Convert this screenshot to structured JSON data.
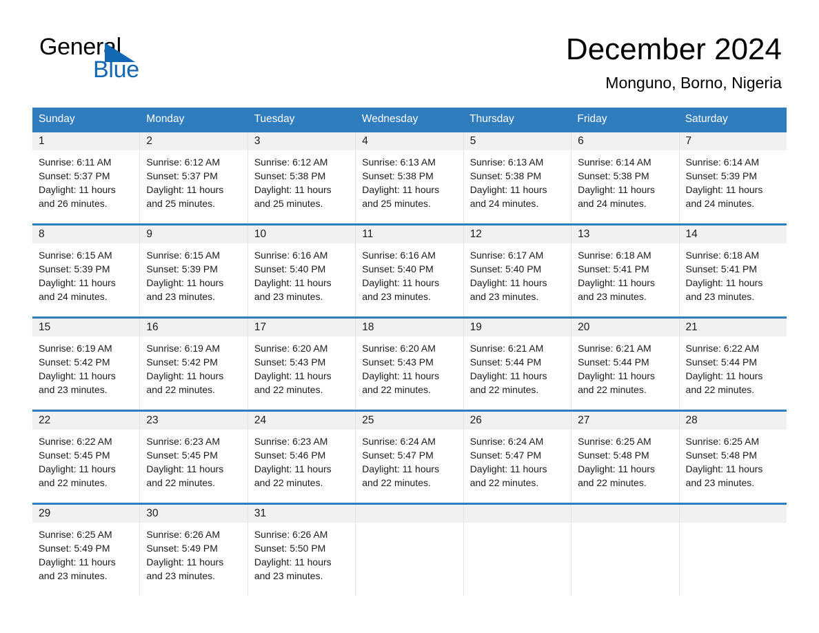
{
  "brand": {
    "name_part1": "General",
    "name_part2": "Blue",
    "accent_color": "#1268b3"
  },
  "header": {
    "month_title": "December 2024",
    "location": "Monguno, Borno, Nigeria"
  },
  "calendar": {
    "header_color": "#2f7cbf",
    "weekdays": [
      "Sunday",
      "Monday",
      "Tuesday",
      "Wednesday",
      "Thursday",
      "Friday",
      "Saturday"
    ],
    "weeks": [
      [
        {
          "day": "1",
          "sunrise": "Sunrise: 6:11 AM",
          "sunset": "Sunset: 5:37 PM",
          "daylight_line1": "Daylight: 11 hours",
          "daylight_line2": "and 26 minutes."
        },
        {
          "day": "2",
          "sunrise": "Sunrise: 6:12 AM",
          "sunset": "Sunset: 5:37 PM",
          "daylight_line1": "Daylight: 11 hours",
          "daylight_line2": "and 25 minutes."
        },
        {
          "day": "3",
          "sunrise": "Sunrise: 6:12 AM",
          "sunset": "Sunset: 5:38 PM",
          "daylight_line1": "Daylight: 11 hours",
          "daylight_line2": "and 25 minutes."
        },
        {
          "day": "4",
          "sunrise": "Sunrise: 6:13 AM",
          "sunset": "Sunset: 5:38 PM",
          "daylight_line1": "Daylight: 11 hours",
          "daylight_line2": "and 25 minutes."
        },
        {
          "day": "5",
          "sunrise": "Sunrise: 6:13 AM",
          "sunset": "Sunset: 5:38 PM",
          "daylight_line1": "Daylight: 11 hours",
          "daylight_line2": "and 24 minutes."
        },
        {
          "day": "6",
          "sunrise": "Sunrise: 6:14 AM",
          "sunset": "Sunset: 5:38 PM",
          "daylight_line1": "Daylight: 11 hours",
          "daylight_line2": "and 24 minutes."
        },
        {
          "day": "7",
          "sunrise": "Sunrise: 6:14 AM",
          "sunset": "Sunset: 5:39 PM",
          "daylight_line1": "Daylight: 11 hours",
          "daylight_line2": "and 24 minutes."
        }
      ],
      [
        {
          "day": "8",
          "sunrise": "Sunrise: 6:15 AM",
          "sunset": "Sunset: 5:39 PM",
          "daylight_line1": "Daylight: 11 hours",
          "daylight_line2": "and 24 minutes."
        },
        {
          "day": "9",
          "sunrise": "Sunrise: 6:15 AM",
          "sunset": "Sunset: 5:39 PM",
          "daylight_line1": "Daylight: 11 hours",
          "daylight_line2": "and 23 minutes."
        },
        {
          "day": "10",
          "sunrise": "Sunrise: 6:16 AM",
          "sunset": "Sunset: 5:40 PM",
          "daylight_line1": "Daylight: 11 hours",
          "daylight_line2": "and 23 minutes."
        },
        {
          "day": "11",
          "sunrise": "Sunrise: 6:16 AM",
          "sunset": "Sunset: 5:40 PM",
          "daylight_line1": "Daylight: 11 hours",
          "daylight_line2": "and 23 minutes."
        },
        {
          "day": "12",
          "sunrise": "Sunrise: 6:17 AM",
          "sunset": "Sunset: 5:40 PM",
          "daylight_line1": "Daylight: 11 hours",
          "daylight_line2": "and 23 minutes."
        },
        {
          "day": "13",
          "sunrise": "Sunrise: 6:18 AM",
          "sunset": "Sunset: 5:41 PM",
          "daylight_line1": "Daylight: 11 hours",
          "daylight_line2": "and 23 minutes."
        },
        {
          "day": "14",
          "sunrise": "Sunrise: 6:18 AM",
          "sunset": "Sunset: 5:41 PM",
          "daylight_line1": "Daylight: 11 hours",
          "daylight_line2": "and 23 minutes."
        }
      ],
      [
        {
          "day": "15",
          "sunrise": "Sunrise: 6:19 AM",
          "sunset": "Sunset: 5:42 PM",
          "daylight_line1": "Daylight: 11 hours",
          "daylight_line2": "and 23 minutes."
        },
        {
          "day": "16",
          "sunrise": "Sunrise: 6:19 AM",
          "sunset": "Sunset: 5:42 PM",
          "daylight_line1": "Daylight: 11 hours",
          "daylight_line2": "and 22 minutes."
        },
        {
          "day": "17",
          "sunrise": "Sunrise: 6:20 AM",
          "sunset": "Sunset: 5:43 PM",
          "daylight_line1": "Daylight: 11 hours",
          "daylight_line2": "and 22 minutes."
        },
        {
          "day": "18",
          "sunrise": "Sunrise: 6:20 AM",
          "sunset": "Sunset: 5:43 PM",
          "daylight_line1": "Daylight: 11 hours",
          "daylight_line2": "and 22 minutes."
        },
        {
          "day": "19",
          "sunrise": "Sunrise: 6:21 AM",
          "sunset": "Sunset: 5:44 PM",
          "daylight_line1": "Daylight: 11 hours",
          "daylight_line2": "and 22 minutes."
        },
        {
          "day": "20",
          "sunrise": "Sunrise: 6:21 AM",
          "sunset": "Sunset: 5:44 PM",
          "daylight_line1": "Daylight: 11 hours",
          "daylight_line2": "and 22 minutes."
        },
        {
          "day": "21",
          "sunrise": "Sunrise: 6:22 AM",
          "sunset": "Sunset: 5:44 PM",
          "daylight_line1": "Daylight: 11 hours",
          "daylight_line2": "and 22 minutes."
        }
      ],
      [
        {
          "day": "22",
          "sunrise": "Sunrise: 6:22 AM",
          "sunset": "Sunset: 5:45 PM",
          "daylight_line1": "Daylight: 11 hours",
          "daylight_line2": "and 22 minutes."
        },
        {
          "day": "23",
          "sunrise": "Sunrise: 6:23 AM",
          "sunset": "Sunset: 5:45 PM",
          "daylight_line1": "Daylight: 11 hours",
          "daylight_line2": "and 22 minutes."
        },
        {
          "day": "24",
          "sunrise": "Sunrise: 6:23 AM",
          "sunset": "Sunset: 5:46 PM",
          "daylight_line1": "Daylight: 11 hours",
          "daylight_line2": "and 22 minutes."
        },
        {
          "day": "25",
          "sunrise": "Sunrise: 6:24 AM",
          "sunset": "Sunset: 5:47 PM",
          "daylight_line1": "Daylight: 11 hours",
          "daylight_line2": "and 22 minutes."
        },
        {
          "day": "26",
          "sunrise": "Sunrise: 6:24 AM",
          "sunset": "Sunset: 5:47 PM",
          "daylight_line1": "Daylight: 11 hours",
          "daylight_line2": "and 22 minutes."
        },
        {
          "day": "27",
          "sunrise": "Sunrise: 6:25 AM",
          "sunset": "Sunset: 5:48 PM",
          "daylight_line1": "Daylight: 11 hours",
          "daylight_line2": "and 22 minutes."
        },
        {
          "day": "28",
          "sunrise": "Sunrise: 6:25 AM",
          "sunset": "Sunset: 5:48 PM",
          "daylight_line1": "Daylight: 11 hours",
          "daylight_line2": "and 23 minutes."
        }
      ],
      [
        {
          "day": "29",
          "sunrise": "Sunrise: 6:25 AM",
          "sunset": "Sunset: 5:49 PM",
          "daylight_line1": "Daylight: 11 hours",
          "daylight_line2": "and 23 minutes."
        },
        {
          "day": "30",
          "sunrise": "Sunrise: 6:26 AM",
          "sunset": "Sunset: 5:49 PM",
          "daylight_line1": "Daylight: 11 hours",
          "daylight_line2": "and 23 minutes."
        },
        {
          "day": "31",
          "sunrise": "Sunrise: 6:26 AM",
          "sunset": "Sunset: 5:50 PM",
          "daylight_line1": "Daylight: 11 hours",
          "daylight_line2": "and 23 minutes."
        },
        {
          "day": "",
          "sunrise": "",
          "sunset": "",
          "daylight_line1": "",
          "daylight_line2": ""
        },
        {
          "day": "",
          "sunrise": "",
          "sunset": "",
          "daylight_line1": "",
          "daylight_line2": ""
        },
        {
          "day": "",
          "sunrise": "",
          "sunset": "",
          "daylight_line1": "",
          "daylight_line2": ""
        },
        {
          "day": "",
          "sunrise": "",
          "sunset": "",
          "daylight_line1": "",
          "daylight_line2": ""
        }
      ]
    ]
  }
}
